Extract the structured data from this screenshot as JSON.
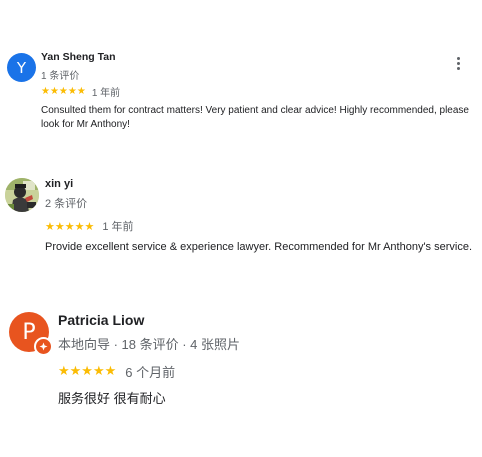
{
  "colors": {
    "star": "#fbbc04",
    "meta": "#5f6368",
    "avatar_y": "#1a73e8",
    "avatar_p": "#e8541f"
  },
  "reviews": [
    {
      "initial": "Y",
      "name": "Yan Sheng Tan",
      "meta": "1 条评价",
      "stars": "★★★★★",
      "rating": 5,
      "date": "1 年前",
      "text": "Consulted them for contract matters! Very patient and clear advice! Highly recommended, please look for Mr Anthony!",
      "more_icon": "more-vert-icon"
    },
    {
      "initial": "",
      "name": "xin yi",
      "meta": "2 条评价",
      "stars": "★★★★★",
      "rating": 5,
      "date": "1 年前",
      "text": "Provide excellent service & experience lawyer. Recommended for Mr Anthony's service."
    },
    {
      "initial": "P",
      "name": "Patricia Liow",
      "meta": "本地向导 · 18 条评价 · 4 张照片",
      "stars": "★★★★★",
      "rating": 5,
      "date": "6 个月前",
      "text": "服务很好 很有耐心",
      "badge_icon": "local-guide-badge-icon"
    }
  ]
}
